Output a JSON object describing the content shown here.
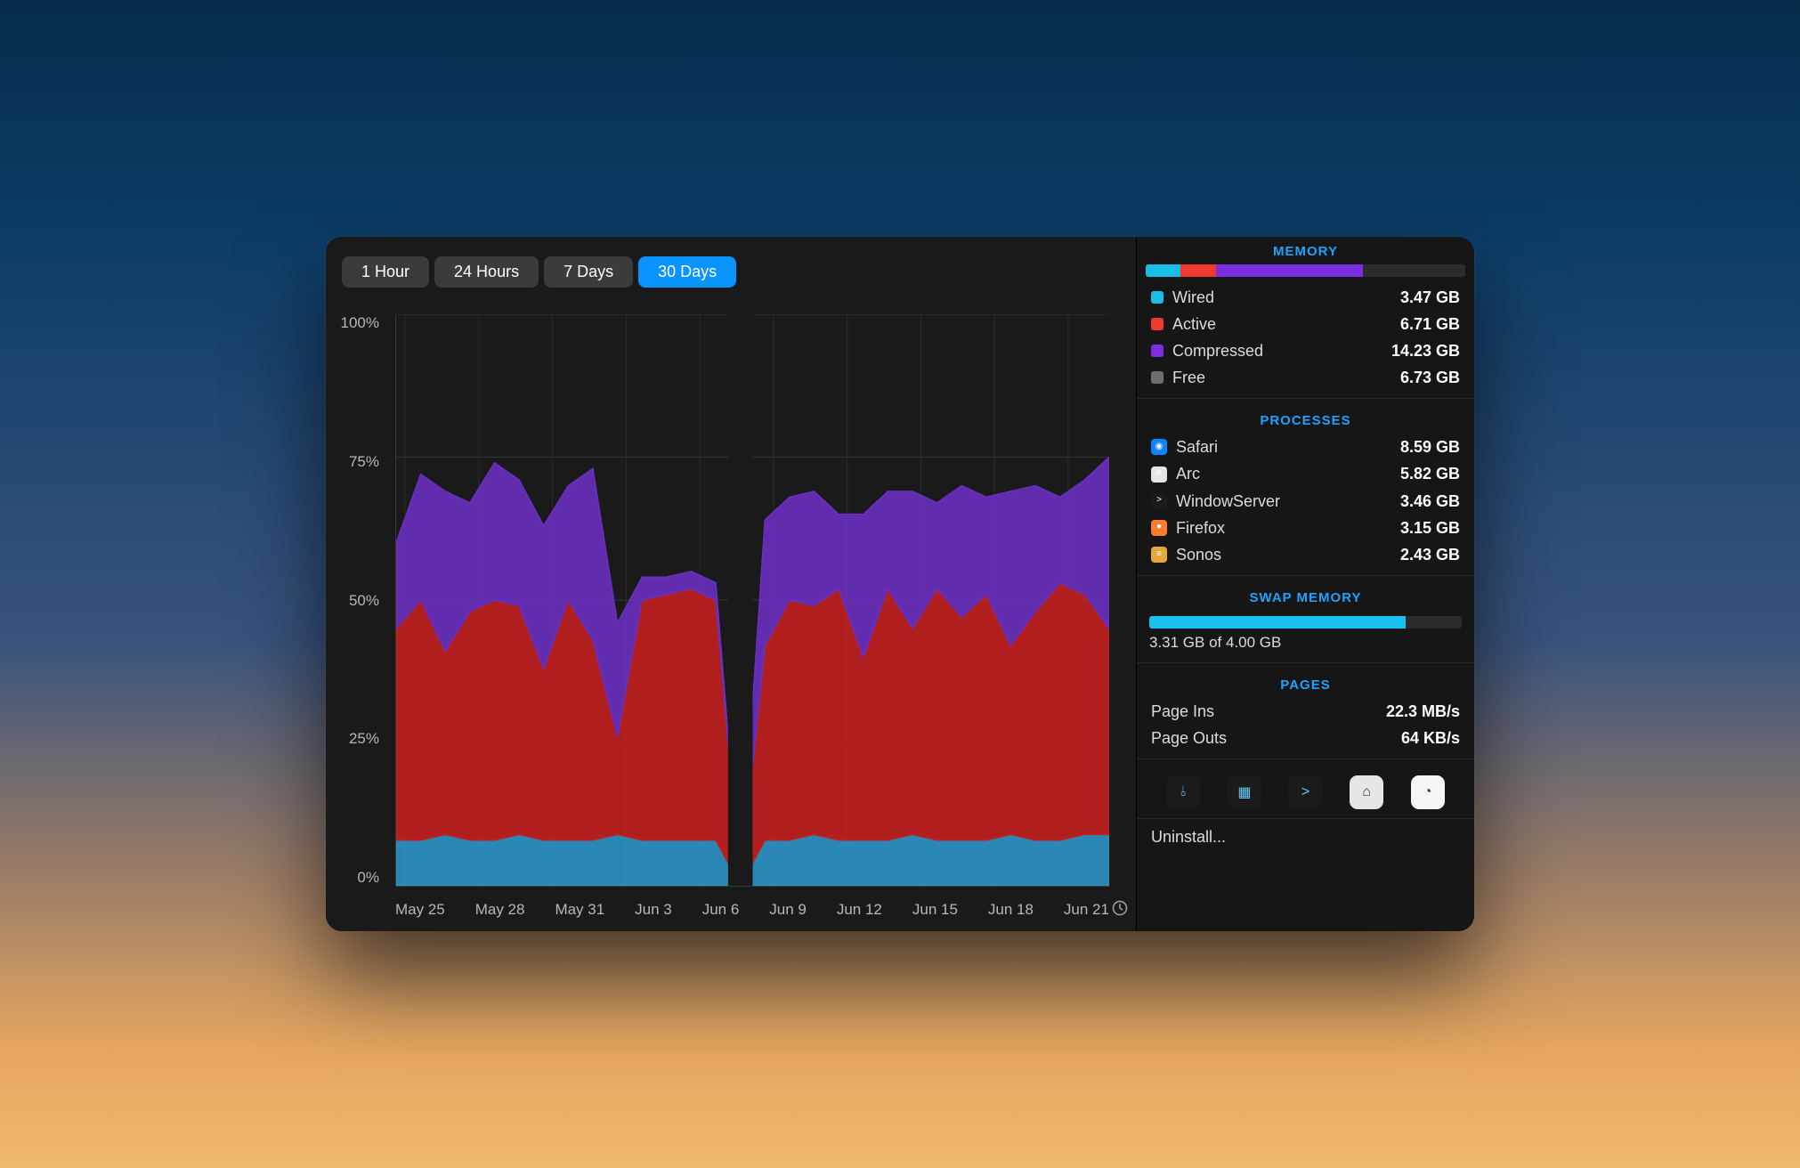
{
  "tabs": [
    "1 Hour",
    "24 Hours",
    "7 Days",
    "30 Days"
  ],
  "active_tab_index": 3,
  "chart_data": {
    "type": "area",
    "title": "",
    "xlabel": "",
    "ylabel": "",
    "ylim": [
      0,
      100
    ],
    "y_ticks": [
      "100%",
      "75%",
      "50%",
      "25%",
      "0%"
    ],
    "x_ticks": [
      "May 25",
      "May 28",
      "May 31",
      "Jun 3",
      "Jun 6",
      "Jun 9",
      "Jun 12",
      "Jun 15",
      "Jun 18",
      "Jun 21"
    ],
    "categories": [
      "May 25",
      "May 26",
      "May 27",
      "May 28",
      "May 29",
      "May 30",
      "May 31",
      "Jun 1",
      "Jun 2",
      "Jun 3",
      "Jun 4",
      "Jun 5",
      "Jun 6",
      "Jun 7",
      "Jun 8",
      "Jun 9",
      "Jun 10",
      "Jun 11",
      "Jun 12",
      "Jun 13",
      "Jun 14",
      "Jun 15",
      "Jun 16",
      "Jun 17",
      "Jun 18",
      "Jun 19",
      "Jun 20",
      "Jun 21",
      "Jun 22",
      "Jun 23"
    ],
    "series": [
      {
        "name": "Wired",
        "color": "#2d93c6",
        "values": [
          8,
          8,
          9,
          8,
          8,
          9,
          8,
          8,
          8,
          9,
          8,
          8,
          8,
          8,
          0,
          8,
          8,
          9,
          8,
          8,
          8,
          9,
          8,
          8,
          8,
          9,
          8,
          8,
          9,
          9
        ]
      },
      {
        "name": "Active",
        "color": "#c11f1f",
        "values": [
          37,
          42,
          32,
          40,
          42,
          40,
          30,
          42,
          35,
          17,
          42,
          43,
          44,
          42,
          0,
          34,
          42,
          40,
          44,
          32,
          44,
          36,
          44,
          39,
          43,
          33,
          40,
          45,
          42,
          36
        ]
      },
      {
        "name": "Compressed",
        "color": "#6a2fbf",
        "values": [
          15,
          22,
          28,
          19,
          24,
          22,
          25,
          20,
          30,
          20,
          4,
          3,
          3,
          3,
          0,
          22,
          18,
          20,
          13,
          25,
          17,
          24,
          15,
          23,
          17,
          27,
          22,
          15,
          20,
          30
        ]
      }
    ],
    "gap_indices": [
      14
    ]
  },
  "memory": {
    "title": "MEMORY",
    "bar": [
      {
        "color": "#17bfe5",
        "pct": 11
      },
      {
        "color": "#f03a2d",
        "pct": 11
      },
      {
        "color": "#7a2ee0",
        "pct": 46
      },
      {
        "color": "#2c2c2c",
        "pct": 32
      }
    ],
    "legend": [
      {
        "color": "#17bfe5",
        "label": "Wired",
        "value": "3.47 GB"
      },
      {
        "color": "#f03a2d",
        "label": "Active",
        "value": "6.71 GB"
      },
      {
        "color": "#7a2ee0",
        "label": "Compressed",
        "value": "14.23 GB"
      },
      {
        "color": "#6e6e6e",
        "label": "Free",
        "value": "6.73 GB"
      }
    ]
  },
  "processes": {
    "title": "PROCESSES",
    "items": [
      {
        "icon_bg": "#0a84ff",
        "icon_glyph": "◉",
        "label": "Safari",
        "value": "8.59 GB"
      },
      {
        "icon_bg": "#e6e6e6",
        "icon_glyph": "A",
        "label": "Arc",
        "value": "5.82 GB"
      },
      {
        "icon_bg": "#1b1b1b",
        "icon_glyph": ">",
        "label": "WindowServer",
        "value": "3.46 GB"
      },
      {
        "icon_bg": "#ff7b2d",
        "icon_glyph": "●",
        "label": "Firefox",
        "value": "3.15 GB"
      },
      {
        "icon_bg": "#e5a83a",
        "icon_glyph": "≡",
        "label": "Sonos",
        "value": "2.43 GB"
      }
    ]
  },
  "swap": {
    "title": "SWAP MEMORY",
    "used_pct": 82,
    "text": "3.31 GB of 4.00 GB"
  },
  "pages": {
    "title": "PAGES",
    "rows": [
      {
        "label": "Page Ins",
        "value": "22.3 MB/s"
      },
      {
        "label": "Page Outs",
        "value": "64 KB/s"
      }
    ]
  },
  "dock": [
    {
      "name": "activity-monitor",
      "bg": "#1b1b1b",
      "glyph": "⫰"
    },
    {
      "name": "console",
      "bg": "#1b1b1b",
      "glyph": "▦"
    },
    {
      "name": "terminal",
      "bg": "#1b1b1b",
      "glyph": ">"
    },
    {
      "name": "cleanup",
      "bg": "#e6e6e6",
      "glyph": "⌂"
    },
    {
      "name": "speedometer",
      "bg": "#f5f5f5",
      "glyph": "◔"
    }
  ],
  "uninstall_label": "Uninstall..."
}
